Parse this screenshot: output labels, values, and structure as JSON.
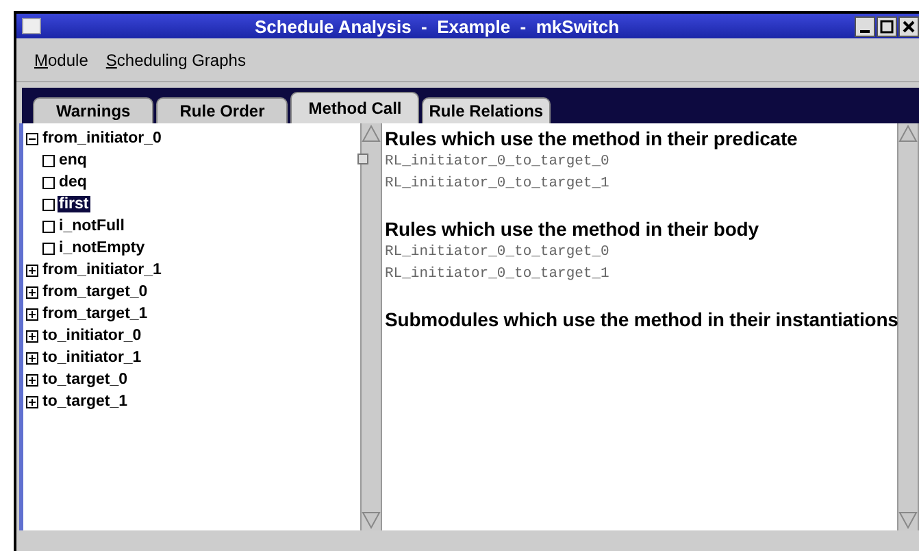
{
  "window": {
    "title": "Schedule Analysis  -  Example  -  mkSwitch"
  },
  "menu": [
    {
      "label": "Module",
      "underline_first": true
    },
    {
      "label": "Scheduling Graphs",
      "underline_first": true
    }
  ],
  "tabs": [
    {
      "label": "Warnings",
      "selected": false
    },
    {
      "label": "Rule Order",
      "selected": false
    },
    {
      "label": "Method Call",
      "selected": true
    },
    {
      "label": "Rule Relations",
      "selected": false
    }
  ],
  "tree": [
    {
      "label": "from_initiator_0",
      "expanded": true,
      "selected": false,
      "children": [
        {
          "label": "enq",
          "selected": false
        },
        {
          "label": "deq",
          "selected": false
        },
        {
          "label": "first",
          "selected": true
        },
        {
          "label": "i_notFull",
          "selected": false
        },
        {
          "label": "i_notEmpty",
          "selected": false
        }
      ]
    },
    {
      "label": "from_initiator_1",
      "expanded": false,
      "selected": false
    },
    {
      "label": "from_target_0",
      "expanded": false,
      "selected": false
    },
    {
      "label": "from_target_1",
      "expanded": false,
      "selected": false
    },
    {
      "label": "to_initiator_0",
      "expanded": false,
      "selected": false
    },
    {
      "label": "to_initiator_1",
      "expanded": false,
      "selected": false
    },
    {
      "label": "to_target_0",
      "expanded": false,
      "selected": false
    },
    {
      "label": "to_target_1",
      "expanded": false,
      "selected": false
    }
  ],
  "details": [
    {
      "heading": "Rules which use the method  in their predicate",
      "rules": [
        "RL_initiator_0_to_target_0",
        "RL_initiator_0_to_target_1"
      ]
    },
    {
      "heading": "Rules which use the method  in their body",
      "rules": [
        "RL_initiator_0_to_target_0",
        "RL_initiator_0_to_target_1"
      ]
    },
    {
      "heading": "Submodules which use the method  in their instantiations"
    }
  ]
}
